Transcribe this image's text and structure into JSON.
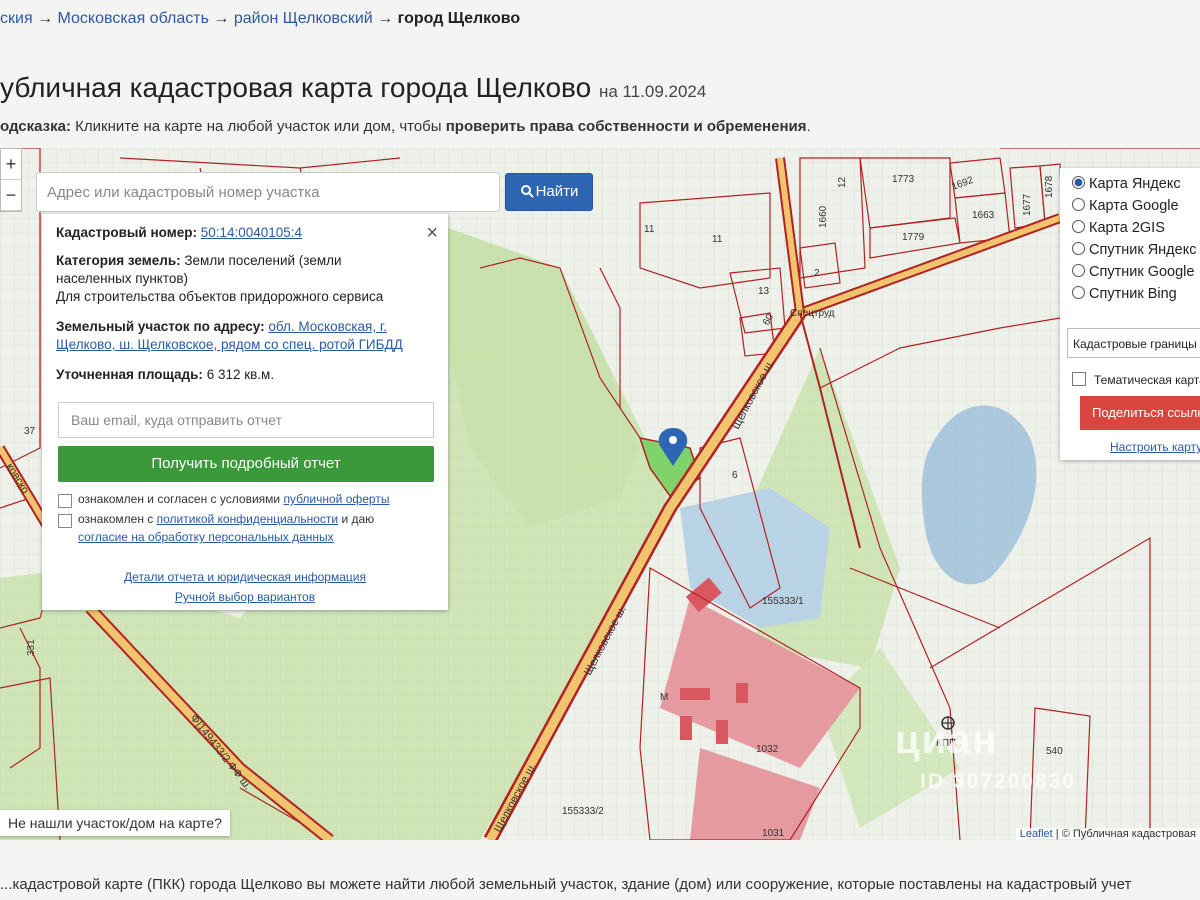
{
  "breadcrumb": {
    "item1": "ския",
    "sep": "→",
    "item2": "Московская область",
    "item3": "район Щелковский",
    "current": "город Щелково"
  },
  "title": {
    "main": "убличная кадастровая карта города Щелково",
    "date": "на 11.09.2024"
  },
  "hint": {
    "label": "одсказка:",
    "text": " Кликните на карте на любой участок или дом, чтобы ",
    "bold": "проверить права собственности и обременения",
    "end": "."
  },
  "search": {
    "placeholder": "Адрес или кадастровый номер участка",
    "button": "Найти"
  },
  "zoom": {
    "plus": "+",
    "minus": "−"
  },
  "panel": {
    "cad_label": "Кадастровый номер:",
    "cad_value": "50:14:0040105:4",
    "cat_label": "Категория земель:",
    "cat_value_1": "Земли поселений (земли",
    "cat_value_2": "населенных пунктов)",
    "cat_value_3": "Для строительства объектов придорожного сервиса",
    "addr_label": "Земельный участок по адресу:",
    "addr_value_1": "обл. Московская, г.",
    "addr_value_2": "Щелково, ш. Щелковское, рядом со спец. ротой ГИБДД",
    "area_label": "Уточненная площадь:",
    "area_value": "6 312 кв.м.",
    "email_placeholder": "Ваш email, куда отправить отчет",
    "report_button": "Получить подробный отчет",
    "check1_text": "ознакомлен и согласен с условиями ",
    "check1_link": "публичной оферты",
    "check2_text": "ознакомлен с ",
    "check2_link": "политикой конфиденциальности",
    "check2_text2": " и даю",
    "check2_link2": "согласие на обработку персональных данных",
    "details_link": "Детали отчета и юридическая информация",
    "manual_link": "Ручной выбор вариантов"
  },
  "layers": {
    "options": [
      "Карта Яндекс",
      "Карта Google",
      "Карта 2GIS",
      "Спутник Яндекс",
      "Спутник Google",
      "Спутник Bing"
    ],
    "selected": "Карта Яндекс",
    "select_value": "Кадастровые границы",
    "thematic": "Тематическая карта",
    "share": "Поделиться ссылкой",
    "setup": "Настроить карту"
  },
  "map_labels": {
    "p11a": "11",
    "p11b": "11",
    "p1660": "1660",
    "p12": "12",
    "p1773": "1773",
    "p1692": "1692",
    "p1663": "1663",
    "p1677": "1677",
    "p1678": "1678",
    "p1779": "1779",
    "p2": "2",
    "p13": "13",
    "p60": "60",
    "spetstrud": "Спецтруд",
    "p6": "6",
    "p155333_1": "155333/1",
    "p1032": "1032",
    "p1031": "1031",
    "p155333_2": "155333/2",
    "p540": "540",
    "kpp": "КПП",
    "p37": "37",
    "p331": "331",
    "m": "М",
    "road1": "Щелковское ш.",
    "road2": "Щелковское ш.",
    "road3": "Щелковское ш.",
    "road4": "Ф]149433/2 ФФ ш.",
    "road5": "ковско"
  },
  "notfound": "Не нашли участок/дом на карте?",
  "attribution": {
    "leaflet": "Leaflet",
    "sep": " | © ",
    "source": "Публичная кадастровая"
  },
  "watermark": {
    "brand": "циан",
    "id": "ID 307200830"
  },
  "bottom_text": "...кадастровой карте (ПКК) города Щелково вы можете найти любой земельный участок, здание (дом) или сооружение, которые поставлены на кадастровый учет",
  "colors": {
    "accent": "#2f66b3",
    "green_button": "#3a9a3a",
    "share_button": "#d9463f",
    "parcel_border": "#b22222",
    "road": "#d9a441"
  }
}
